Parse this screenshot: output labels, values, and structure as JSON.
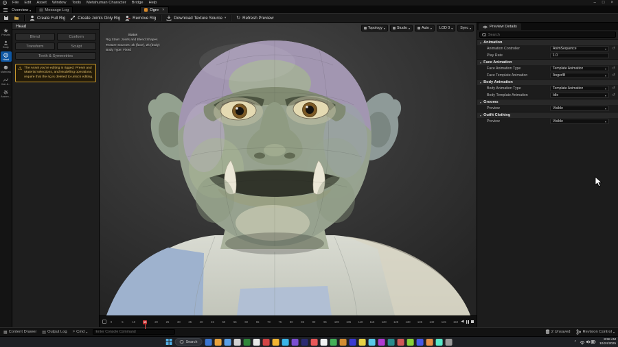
{
  "icons": {
    "chevron_down": "▾",
    "close": "×",
    "minimize": "–",
    "maximize": "□",
    "refresh": "↻",
    "reset": "↺",
    "warning": "⚠",
    "grid": "▦",
    "list": "▤",
    "prev": "◀",
    "cmd_prompt": ">"
  },
  "menu_bar": {
    "items": [
      "File",
      "Edit",
      "Asset",
      "Window",
      "Tools",
      "Metahuman Character",
      "Bridge",
      "Help"
    ]
  },
  "tab_bar": {
    "overview_label": "Overview",
    "message_log_label": "Message Log",
    "asset_tab_label": "Ogre"
  },
  "toolbar": {
    "create_full_rig": "Create Full Rig",
    "create_joints_only_rig": "Create Joints Only Rig",
    "remove_rig": "Remove Rig",
    "download_texture_source": "Download Texture Source",
    "refresh_preview": "Refresh Preview"
  },
  "side_strip": {
    "items": [
      {
        "label": "Presets"
      },
      {
        "label": "Body"
      },
      {
        "label": "Head"
      },
      {
        "label": "Materials"
      },
      {
        "label": "Hair &..."
      },
      {
        "label": "Assem..."
      }
    ]
  },
  "head_panel": {
    "title": "Head",
    "tools": [
      "Blend",
      "Conform",
      "Transform",
      "Sculpt"
    ],
    "wide_tool": "Teeth & Symmetries",
    "warning": "The Asset you're editing is rigged. Preset and Material selections, and Modelling operations, require that the rig is deleted to unlock editing."
  },
  "viewport": {
    "status_title": "Status",
    "status_lines": [
      "Rig State: Joints and Blend Shapes",
      "Texture Sources: 2k (face), 2k (body)",
      "Body Type: Fixed"
    ],
    "controls": [
      {
        "label": "Topology"
      },
      {
        "label": "Studio"
      },
      {
        "label": "Auto"
      },
      {
        "label": "LOD 0"
      },
      {
        "label": "Sync"
      }
    ]
  },
  "timeline": {
    "ticks": [
      0,
      5,
      10,
      15,
      20,
      25,
      30,
      35,
      40,
      45,
      50,
      55,
      60,
      65,
      70,
      75,
      80,
      85,
      90,
      95,
      100,
      105,
      110,
      115,
      120,
      125,
      130,
      135,
      140,
      145,
      150
    ],
    "playhead_frame": 15
  },
  "details_panel": {
    "tab_label": "Preview Details",
    "search_placeholder": "Search",
    "sections": [
      {
        "title": "Animation",
        "rows": [
          {
            "label": "Animation Controller",
            "value": "AnimSequence"
          },
          {
            "label": "Play Rate",
            "value": "1.0"
          }
        ]
      },
      {
        "title": "Face Animation",
        "rows": [
          {
            "label": "Face Animation Type",
            "value": "Template Animation"
          },
          {
            "label": "Face Template Animation",
            "value": "Anger/B"
          }
        ]
      },
      {
        "title": "Body Animation",
        "rows": [
          {
            "label": "Body Animation Type",
            "value": "Template Animation"
          },
          {
            "label": "Body Template Animation",
            "value": "Idle"
          }
        ]
      },
      {
        "title": "Grooms",
        "rows": [
          {
            "label": "Preview",
            "value": "Visible"
          }
        ]
      },
      {
        "title": "Outfit Clothing",
        "rows": [
          {
            "label": "Preview",
            "value": "Visible"
          }
        ]
      }
    ]
  },
  "status_bar": {
    "content_drawer": "Content Drawer",
    "output_log": "Output Log",
    "cmd_label": "Cmd",
    "console_placeholder": "Enter Console Command",
    "unsaved": "2 Unsaved",
    "revision_control": "Revision Control"
  },
  "taskbar": {
    "search_label": "Search",
    "time": "8:58 AM",
    "date": "10/24/2025",
    "app_icon_colors": [
      "#3a76d2",
      "#e8a33d",
      "#5aa0e8",
      "#d2d2d2",
      "#30873a",
      "#e8e8e8",
      "#d24545",
      "#f2b632",
      "#3ab5e8",
      "#7a4fd2",
      "#2a2a72",
      "#e85858",
      "#f2f2f2",
      "#45b058",
      "#d28c32",
      "#3a3ad2",
      "#e8d245",
      "#58c8e8",
      "#b03ad2",
      "#2a8c8c",
      "#d25858",
      "#88d23a",
      "#4558e8",
      "#e89045",
      "#58e8c8",
      "#9a9a9a"
    ]
  }
}
